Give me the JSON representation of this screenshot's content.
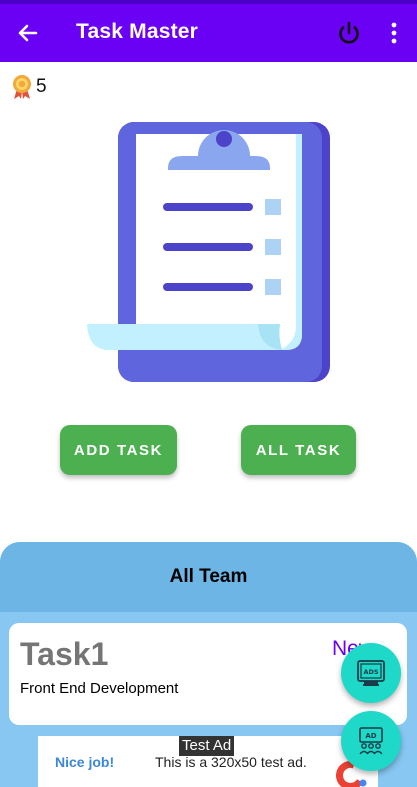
{
  "appbar": {
    "title": "Task Master",
    "back_icon": "arrow-left-icon",
    "power_icon": "power-icon",
    "menu_icon": "more-vert-icon"
  },
  "rewards": {
    "count": "5",
    "icon": "medal-icon"
  },
  "illustration": "clipboard-checklist",
  "buttons": {
    "add_task": "ADD TASK",
    "all_task": "ALL TASK"
  },
  "team": {
    "header": "All Team",
    "tasks": [
      {
        "name": "Task1",
        "description": "Front End Development",
        "status": "New"
      }
    ]
  },
  "ad": {
    "badge": "Test Ad",
    "label": "Nice job!",
    "text": "This is a 320x50 test ad."
  },
  "fabs": [
    {
      "icon": "ads-icon",
      "label": "ADS"
    },
    {
      "icon": "ad-audience-icon",
      "label": "AD"
    }
  ],
  "colors": {
    "appbar": "#6a00f4",
    "button": "#4caf50",
    "team_header": "#6cb5e4",
    "fab": "#1ed8c8"
  }
}
